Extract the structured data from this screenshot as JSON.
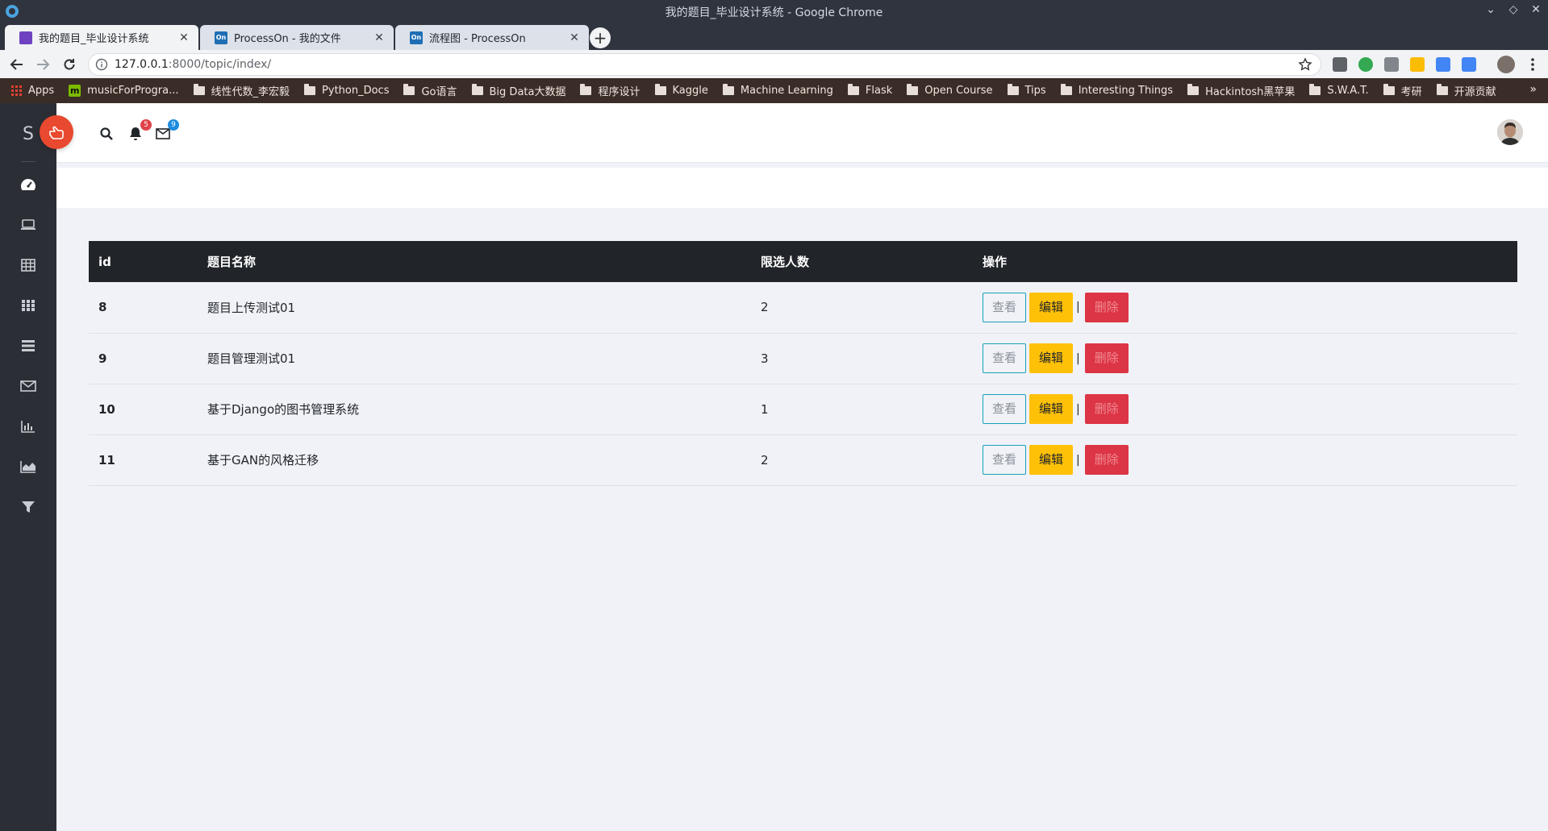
{
  "window": {
    "title": "我的题目_毕业设计系统 - Google Chrome",
    "controls": [
      "⌄",
      "◇",
      "✕"
    ]
  },
  "tabs": [
    {
      "label": "我的题目_毕业设计系统",
      "active": true,
      "favicon_color": "#6f42c1"
    },
    {
      "label": "ProcessOn - 我的文件",
      "active": false,
      "favicon_color": "#1f6fb5",
      "favicon_text": "On"
    },
    {
      "label": "流程图 - ProcessOn",
      "active": false,
      "favicon_color": "#1f6fb5",
      "favicon_text": "On"
    }
  ],
  "toolbar": {
    "url_host": "127.0.0.1",
    "url_path": ":8000/topic/index/",
    "new_tab_symbol": "+"
  },
  "bookmarks": [
    {
      "label": "Apps",
      "kind": "apps"
    },
    {
      "label": "musicForProgra...",
      "kind": "m"
    },
    {
      "label": "线性代数_李宏毅",
      "kind": "folder"
    },
    {
      "label": "Python_Docs",
      "kind": "folder"
    },
    {
      "label": "Go语言",
      "kind": "folder"
    },
    {
      "label": "Big Data大数据",
      "kind": "folder"
    },
    {
      "label": "程序设计",
      "kind": "folder"
    },
    {
      "label": "Kaggle",
      "kind": "folder"
    },
    {
      "label": "Machine Learning",
      "kind": "folder"
    },
    {
      "label": "Flask",
      "kind": "folder"
    },
    {
      "label": "Open Course",
      "kind": "folder"
    },
    {
      "label": "Tips",
      "kind": "folder"
    },
    {
      "label": "Interesting Things",
      "kind": "folder"
    },
    {
      "label": "Hackintosh黑苹果",
      "kind": "folder"
    },
    {
      "label": "S.W.A.T.",
      "kind": "folder"
    },
    {
      "label": "考研",
      "kind": "folder"
    },
    {
      "label": "开源贡献",
      "kind": "folder"
    }
  ],
  "bookmarks_more": "»",
  "app": {
    "brand_letter": "S",
    "notifications_count": "5",
    "messages_count": "9",
    "sidebar_icons": [
      "dashboard-icon",
      "laptop-icon",
      "table-icon",
      "grid-icon",
      "list-icon",
      "envelope-icon",
      "bar-chart-icon",
      "area-chart-icon",
      "filter-icon"
    ]
  },
  "table": {
    "headers": {
      "id": "id",
      "name": "题目名称",
      "limit": "限选人数",
      "actions": "操作"
    },
    "rows": [
      {
        "id": "8",
        "name": "题目上传测试01",
        "limit": "2"
      },
      {
        "id": "9",
        "name": "题目管理测试01",
        "limit": "3"
      },
      {
        "id": "10",
        "name": "基于Django的图书管理系统",
        "limit": "1"
      },
      {
        "id": "11",
        "name": "基于GAN的风格迁移",
        "limit": "2"
      }
    ],
    "actions": {
      "view": "查看",
      "edit": "编辑",
      "separator": "|",
      "delete": "删除"
    }
  },
  "colors": {
    "sidebar_bg": "#2b2f35",
    "fab": "#e8492f",
    "table_header": "#212529",
    "edit": "#ffc107",
    "delete": "#dc3545",
    "view_border": "#17a2b8"
  }
}
